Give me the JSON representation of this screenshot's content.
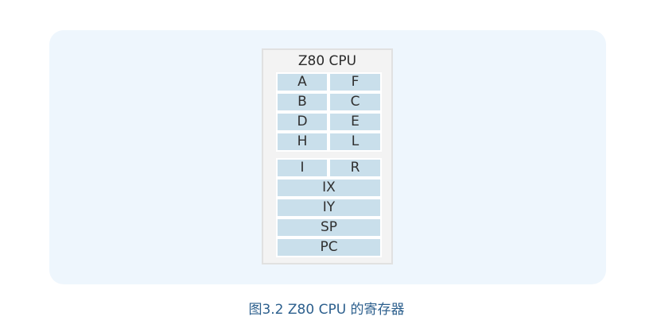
{
  "diagram": {
    "title": "Z80 CPU",
    "register_pairs": [
      {
        "left": "A",
        "right": "F"
      },
      {
        "left": "B",
        "right": "C"
      },
      {
        "left": "D",
        "right": "E"
      },
      {
        "left": "H",
        "right": "L"
      }
    ],
    "special_pair": {
      "left": "I",
      "right": "R"
    },
    "wide_registers": [
      "IX",
      "IY",
      "SP",
      "PC"
    ]
  },
  "caption": "图3.2 Z80 CPU 的寄存器",
  "colors": {
    "panel_background": "#eef6fd",
    "register_fill": "#c9dfeb",
    "caption_text": "#2c5f8d"
  }
}
